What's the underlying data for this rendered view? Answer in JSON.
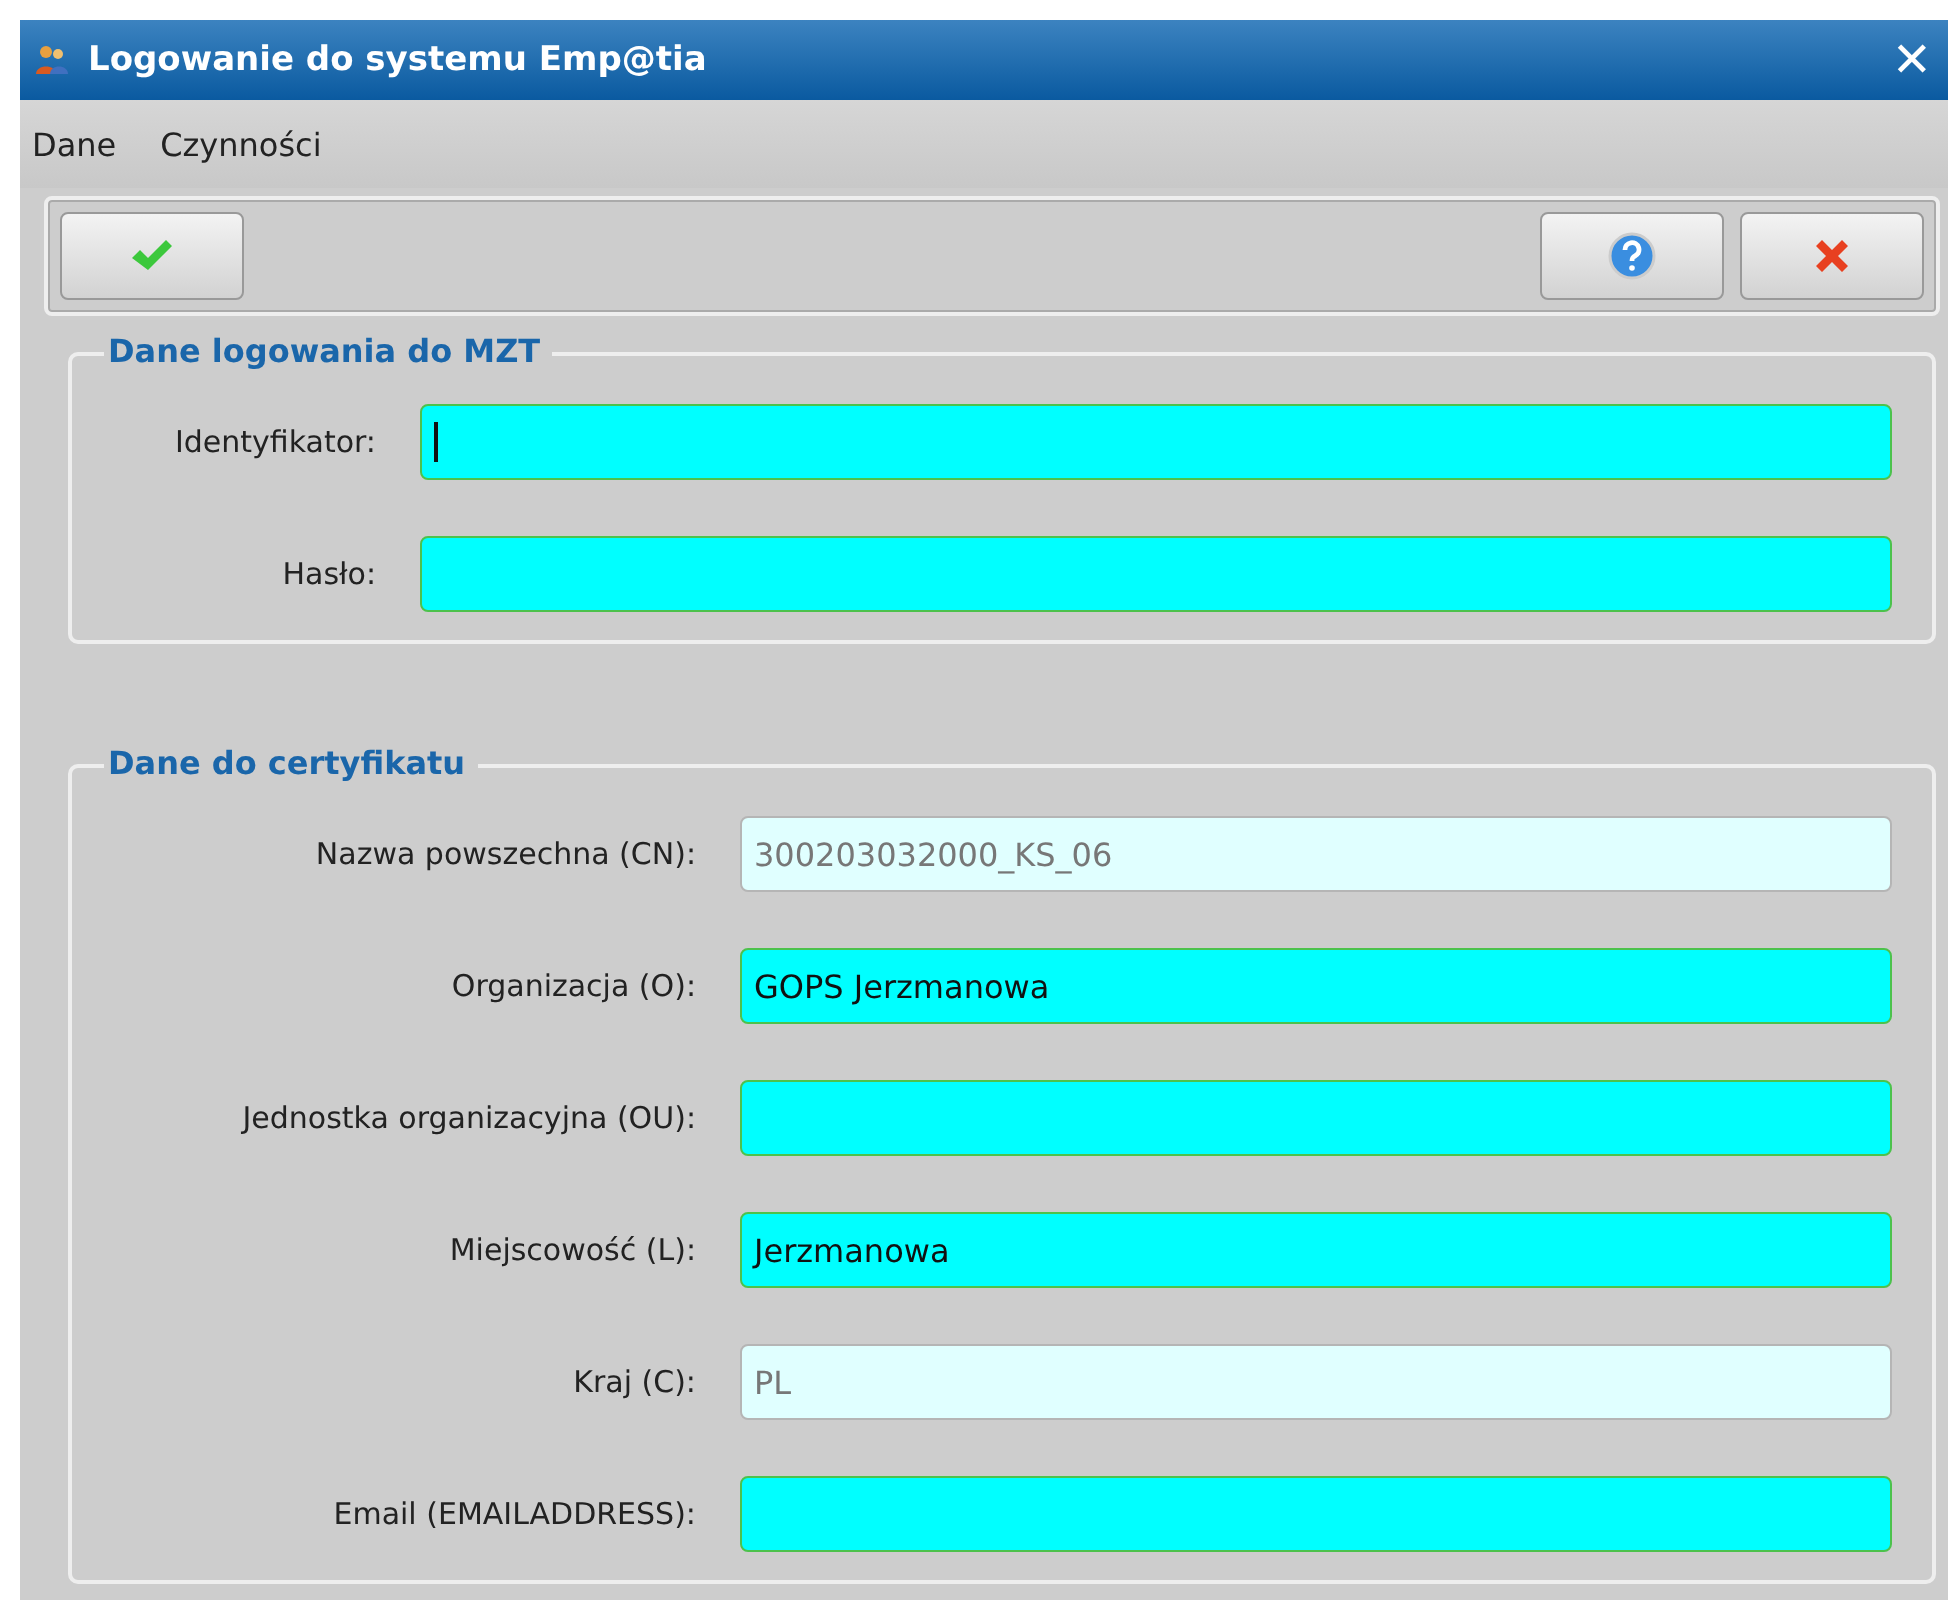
{
  "window": {
    "title": "Logowanie do systemu Emp@tia",
    "close": "✕"
  },
  "menu": [
    {
      "label": "Dane"
    },
    {
      "label": "Czynności"
    }
  ],
  "groups": [
    {
      "title": "Dane logowania do MZT",
      "fields": [
        {
          "label": "Identyfikator:",
          "disabled": false,
          "focused": true
        },
        {
          "label": "Hasło:",
          "disabled": false,
          "focused": false
        }
      ]
    },
    {
      "title": "Dane do certyfikatu",
      "fields": [
        {
          "label": "Nazwa powszechna (CN):",
          "value": "300203032000_KS_06",
          "disabled": true,
          "focused": false
        },
        {
          "label": "Organizacja (O):",
          "value": "GOPS Jerzmanowa",
          "disabled": false,
          "focused": false
        },
        {
          "label": "Jednostka organizacyjna (OU):",
          "disabled": false,
          "focused": false
        },
        {
          "label": "Miejscowość (L):",
          "value": "Jerzmanowa",
          "disabled": false,
          "focused": false
        },
        {
          "label": "Kraj (C):",
          "value": "PL",
          "disabled": true,
          "focused": false
        },
        {
          "label": "Email (EMAILADDRESS):",
          "disabled": false,
          "focused": false
        }
      ]
    }
  ]
}
